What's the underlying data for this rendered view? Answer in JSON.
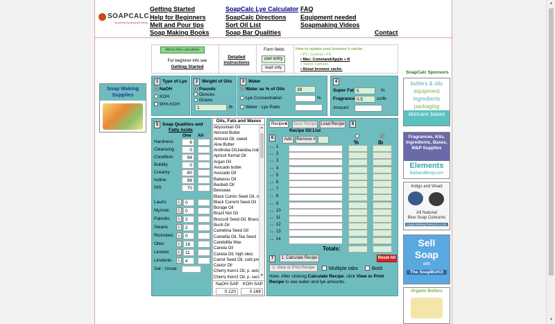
{
  "logo": {
    "brand": "SOAPCALC",
    "tagline": "powered by Bramble Berry"
  },
  "nav": {
    "getting_started": "Getting Started",
    "help_beginners": "Help for Beginners",
    "melt_pour": "Melt and Pour tips",
    "soap_books": "Soap Making Books",
    "lye_calc": "SoapCalc Lye Calculator",
    "faq": "FAQ",
    "directions": "SoapCalc Directions",
    "equipment": "Equipment needed",
    "sort_oil": "Sort Oil List",
    "videos": "Soapmaking Videos",
    "bar_qualities": "Soap Bar Qualities",
    "contact": "Contact"
  },
  "top": {
    "about_btn": "About this calculator",
    "beginner_text": "For beginner info see",
    "getting_started_link": "Getting Started",
    "detailed": "Detailed",
    "instructions": "instructions",
    "form_fields": "Form fields",
    "user_entry": "user entry",
    "read_only": "read only",
    "cache_title": "How to update your browser's cache:",
    "cache_pc": "PC: Control + F5",
    "cache_mac": "Mac: Command/Apple + R",
    "cache_tablet": "Tablet: Refresh",
    "cache_about": "About browser cache."
  },
  "lye": {
    "num": "1",
    "title": "Type of Lye",
    "naoh": "NaOH",
    "koh": "KOH",
    "koh90": "90% KOH"
  },
  "weight": {
    "num": "2",
    "title": "Weight of Oils",
    "pounds": "Pounds",
    "ounces": "Ounces",
    "grams": "Grams",
    "value": "1",
    "unit": "lb"
  },
  "water": {
    "num": "3",
    "title": "Water",
    "pct_label": "Water as % of Oils",
    "pct_value": "38",
    "conc_label": "Lye Concentration",
    "pct_sign": "%",
    "ratio_label": "Water : Lye Ratio",
    "ratio_sep": ":"
  },
  "superfat": {
    "num": "4",
    "sf_label": "Super Fat",
    "sf_value": "5",
    "sf_unit": "%",
    "fr_label": "Fragrance",
    "fr_value": "0.5",
    "fr_unit": "oz/lb",
    "amount_label": "Amount"
  },
  "qualities": {
    "num": "5",
    "title": "Soap Qualities and",
    "title2": "Fatty Acids",
    "col_one": "One",
    "col_all": "All",
    "rows": [
      {
        "name": "Hardness",
        "value": "6"
      },
      {
        "name": "Cleansing",
        "value": "0"
      },
      {
        "name": "Condition",
        "value": "94"
      },
      {
        "name": "Bubbly",
        "value": "0"
      },
      {
        "name": "Creamy",
        "value": "80"
      },
      {
        "name": "Iodine",
        "value": "98"
      },
      {
        "name": "INS",
        "value": "70"
      }
    ],
    "fatty": [
      {
        "name": "Lauric",
        "value": "0"
      },
      {
        "name": "Myristic",
        "value": "0"
      },
      {
        "name": "Palmitic",
        "value": "3"
      },
      {
        "name": "Stearic",
        "value": "2"
      },
      {
        "name": "Ricinoleic",
        "value": "0"
      },
      {
        "name": "Oleic",
        "value": "18"
      },
      {
        "name": "Linoleic",
        "value": "11"
      },
      {
        "name": "Linolenic",
        "value": "4"
      }
    ],
    "l_btn": "L",
    "sat_label": "Sat : Unsat"
  },
  "oils": {
    "title": "Oils, Fats and Waxes",
    "list": [
      "Abyssinian Oil",
      "Almond Butter",
      "Almond Oil, sweet",
      "Aloe Butter",
      "Andiroba Oil,karaba,crab",
      "Apricot Kernal Oil",
      "Argan Oil",
      "Avocado butter",
      "Avocado Oil",
      "Babassu Oil",
      "Baobab Oil",
      "Beeswax",
      "Black Cumin Seed Oil, ni",
      "Black Current Seed Oil",
      "Borage Oil",
      "Brazil Nut Oil",
      "Broccoli Seed Oil, Brassi",
      "Buriti Oil",
      "Camelina Seed Oil",
      "Camellia Oil, Tea Seed",
      "Candelilla Wax",
      "Canola Oil",
      "Canola Oil, high oleic",
      "Carrot Seed Oil, cold pres",
      "Castor Oil",
      "Cherry Kern1 Oil, p. aviur",
      "Cherry Kern2 Oil, p. cerat",
      "Chicken Fat",
      "Cocoa Butter",
      "Coconut Oil, 76 deg"
    ],
    "naoh_sap_label": "NaOH SAP",
    "koh_sap_label": "KOH SAP",
    "naoh_sap": "0.120",
    "koh_sap": "0.168"
  },
  "recipe": {
    "num": "6",
    "select": "Recipe 1",
    "save_btn": "Save Recipe",
    "load_btn": "Load Recipe",
    "num8": "8",
    "list_title": "Recipe Oil List",
    "add_btn": "Add",
    "remove_btn": "Remove #",
    "pct_col": "%",
    "lb_col": "lb",
    "row_nums": [
      "1",
      "2",
      "3",
      "4",
      "5",
      "6",
      "7",
      "8",
      "9",
      "10",
      "11",
      "12",
      "13",
      "14"
    ],
    "totals": "Totals:",
    "num7": "7",
    "calc_btn": "1. Calculate Recipe",
    "reset_btn": "Reset All",
    "view_btn": "2. View or Print Recipe",
    "multi_tabs": "Multiple tabs",
    "bold_label": "Bold",
    "note_pre": "Note: After clicking ",
    "note_calc": "Calculate Recipe",
    "note_mid": ", click ",
    "note_view": "View or Print Recipe",
    "note_post": " to see water and lye amounts."
  },
  "left_ad": {
    "text": "Soap Making Supplies"
  },
  "sponsors": {
    "title": "SoapCalc Sponsors",
    "ad1": [
      "butters & oils",
      "equipment",
      "ingredients",
      "packaging",
      "skincare bases"
    ],
    "ad2_text": "Fragrances, Kits, Ingredients, Bases, M&P Supplies",
    "ad2_brand": "Elements",
    "ad2_sub": "BathandBody.com",
    "ad3_title": "Indigo and Woad",
    "ad3_l1": "All Natural",
    "ad3_l2": "Blue Soap Colorants",
    "ad3_l3": "Soap-Making-Resource.com",
    "ad4_l1": "Sell",
    "ad4_l2": "Soap",
    "ad4_l3": "with",
    "ad4_l4": "The SoapBizKit",
    "ad5_title": "Organic Butters"
  }
}
